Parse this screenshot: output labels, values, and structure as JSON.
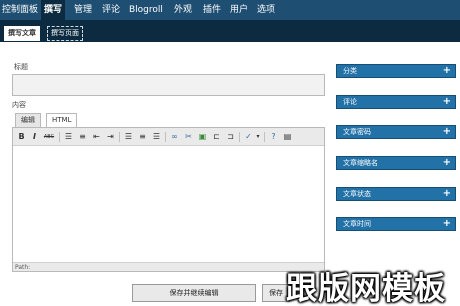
{
  "topnav": {
    "items": [
      "控制面板",
      "撰写",
      "管理",
      "评论",
      "Blogroll",
      "外观",
      "插件",
      "用户",
      "选项"
    ]
  },
  "subnav": {
    "tabs": [
      "撰写文章",
      "撰写页面"
    ]
  },
  "post": {
    "title_label": "标题",
    "content_label": "内容",
    "tabs": [
      "编辑",
      "HTML"
    ],
    "path_label": "Path:"
  },
  "toolbar": {
    "bold": "B",
    "italic": "I",
    "strike": "ABC"
  },
  "buttons": {
    "save_continue": "保存并继续编辑",
    "save": "保存"
  },
  "sidebar": {
    "boxes": [
      "分类",
      "评论",
      "文章密码",
      "文章缩略名",
      "文章状态",
      "文章时间"
    ],
    "expand_symbol": "+"
  },
  "watermark": "跟版网模板"
}
